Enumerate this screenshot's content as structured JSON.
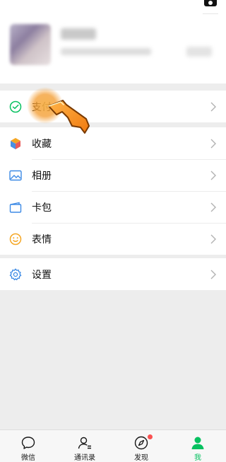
{
  "menu": {
    "pay": "支付",
    "favorites": "收藏",
    "album": "相册",
    "cards": "卡包",
    "stickers": "表情",
    "settings": "设置"
  },
  "tabbar": {
    "chats": "微信",
    "contacts": "通讯录",
    "discover": "发现",
    "me": "我",
    "active": "me"
  },
  "colors": {
    "accent": "#07c160",
    "badge": "#fa5151",
    "pointer": "#f28b1e"
  }
}
